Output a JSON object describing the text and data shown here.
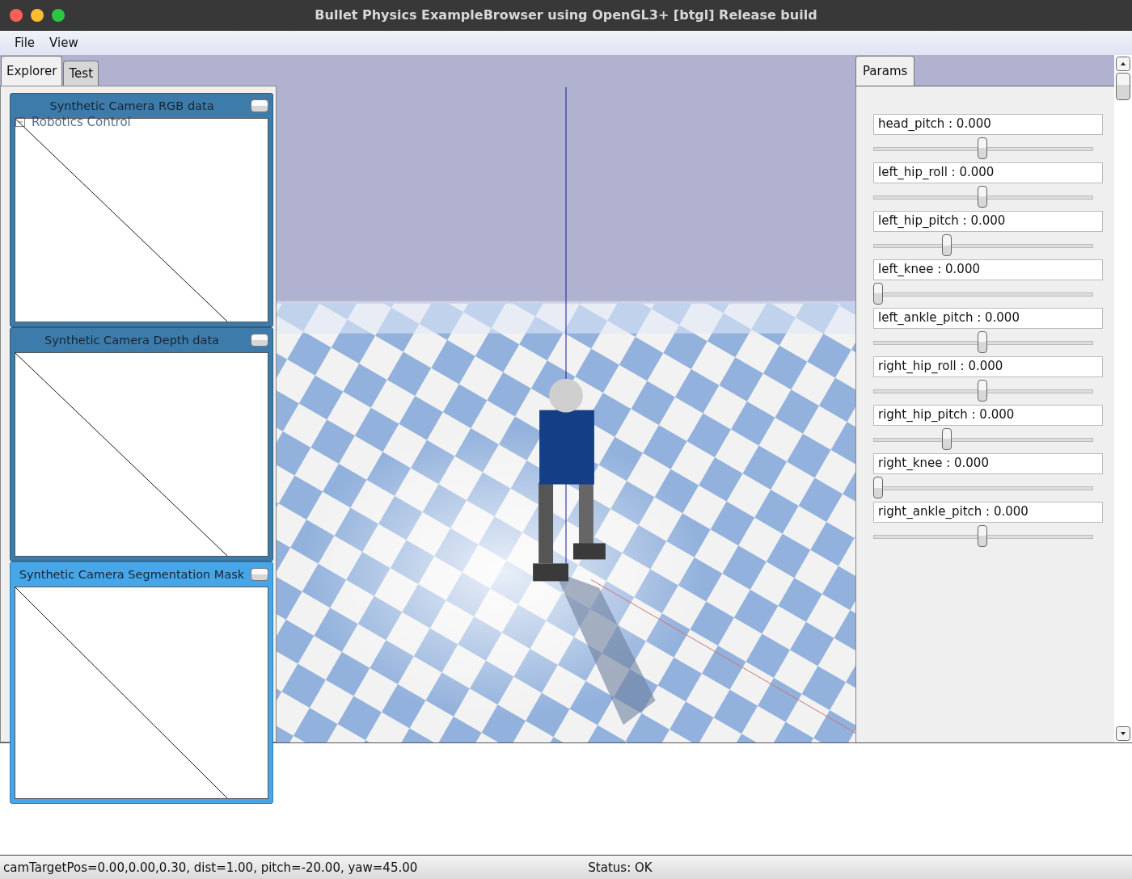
{
  "window": {
    "title": "Bullet Physics ExampleBrowser using OpenGL3+ [btgl] Release build"
  },
  "menu": [
    "File",
    "View"
  ],
  "left_tabs": [
    {
      "label": "Explorer",
      "selected": true
    },
    {
      "label": "Test",
      "selected": false
    }
  ],
  "explorer_tree": [
    {
      "label": "Robotics Control",
      "expanded": true
    }
  ],
  "camera_windows": [
    {
      "title": "Synthetic Camera RGB data",
      "active": false
    },
    {
      "title": "Synthetic Camera Depth data",
      "active": false
    },
    {
      "title": "Synthetic Camera Segmentation Mask",
      "active": true
    }
  ],
  "viewport": {
    "kind": "picture"
  },
  "params_tabs": [
    {
      "label": "Params",
      "selected": true
    }
  ],
  "params": [
    {
      "label": "head_pitch : 0.000",
      "level": 0.5
    },
    {
      "label": "left_hip_roll : 0.000",
      "level": 0.5
    },
    {
      "label": "left_hip_pitch : 0.000",
      "level": 0.33
    },
    {
      "label": "left_knee : 0.000",
      "level": 0
    },
    {
      "label": "left_ankle_pitch : 0.000",
      "level": 0.5
    },
    {
      "label": "right_hip_roll : 0.000",
      "level": 0.5
    },
    {
      "label": "right_hip_pitch : 0.000",
      "level": 0.33
    },
    {
      "label": "right_knee : 0.000",
      "level": 0
    },
    {
      "label": "right_ankle_pitch : 0.000",
      "level": 0.5
    }
  ],
  "status_bar": {
    "camera": "camTargetPos=0.00,0.00,0.30, dist=1.00, pitch=-20.00, yaw=45.00",
    "status": "Status: OK"
  }
}
